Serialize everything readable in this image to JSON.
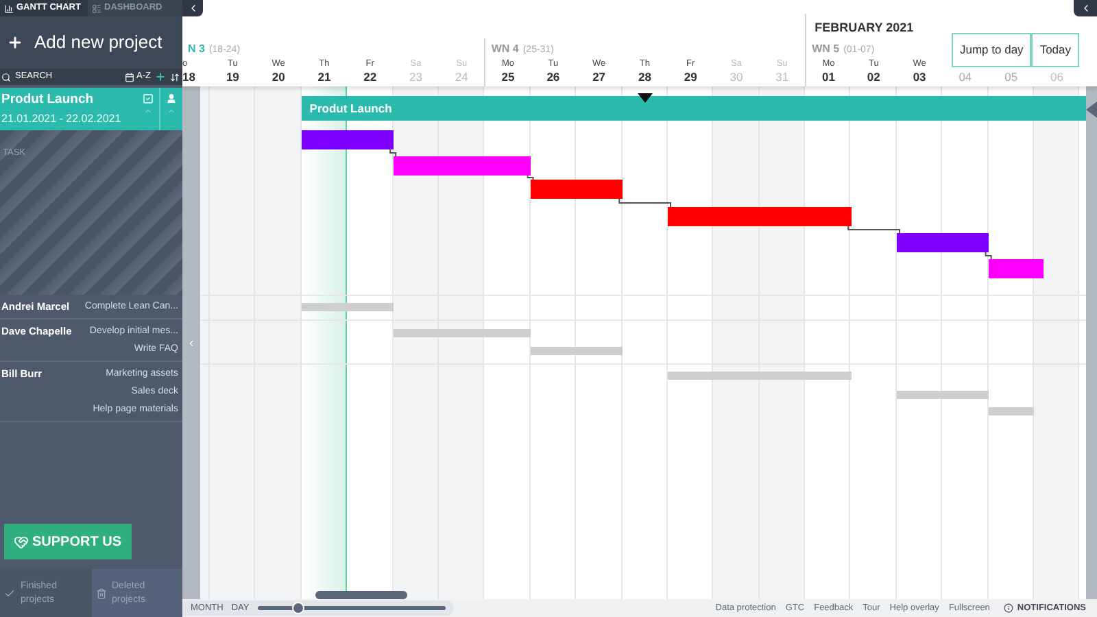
{
  "sidebar": {
    "tabs": [
      {
        "label": "GANTT CHART",
        "selected": true
      },
      {
        "label": "DASHBOARD",
        "selected": false
      }
    ],
    "add_project": "Add new project",
    "search": {
      "label": "SEARCH"
    },
    "sort_label": "A-Z",
    "project": {
      "name": "Produt Launch",
      "dates": "21.01.2021 - 22.02.2021",
      "selected": true
    },
    "task_header": "TASK",
    "resources": [
      {
        "name": "Andrei Marcel",
        "tasks": [
          "Complete Lean Can..."
        ]
      },
      {
        "name": "Dave Chapelle",
        "tasks": [
          "Develop initial mes...",
          "Write FAQ"
        ]
      },
      {
        "name": "Bill Burr",
        "tasks": [
          "Marketing assets",
          "Sales deck",
          "Help page materials"
        ]
      }
    ],
    "support_button": "SUPPORT US",
    "bottom_links": [
      "Finished projects",
      "Deleted projects"
    ]
  },
  "timeline": {
    "month": "FEBRUARY 2021",
    "weeks": [
      {
        "label": "N 3",
        "range": "(18-24)",
        "current": true
      },
      {
        "label": "WN 4",
        "range": "(25-31)",
        "current": false
      },
      {
        "label": "WN 5",
        "range": "(01-07)",
        "current": false
      }
    ],
    "days": [
      {
        "name": "o",
        "date": "18",
        "weekend": false
      },
      {
        "name": "Tu",
        "date": "19",
        "weekend": false
      },
      {
        "name": "We",
        "date": "20",
        "weekend": false
      },
      {
        "name": "Th",
        "date": "21",
        "weekend": false
      },
      {
        "name": "Fr",
        "date": "22",
        "weekend": false
      },
      {
        "name": "Sa",
        "date": "23",
        "weekend": true
      },
      {
        "name": "Su",
        "date": "24",
        "weekend": true
      },
      {
        "name": "Mo",
        "date": "25",
        "weekend": false
      },
      {
        "name": "Tu",
        "date": "26",
        "weekend": false
      },
      {
        "name": "We",
        "date": "27",
        "weekend": false
      },
      {
        "name": "Th",
        "date": "28",
        "weekend": false
      },
      {
        "name": "Fr",
        "date": "29",
        "weekend": false
      },
      {
        "name": "Sa",
        "date": "30",
        "weekend": true
      },
      {
        "name": "Su",
        "date": "31",
        "weekend": true
      },
      {
        "name": "Mo",
        "date": "01",
        "weekend": false
      },
      {
        "name": "Tu",
        "date": "02",
        "weekend": false
      },
      {
        "name": "We",
        "date": "03",
        "weekend": false
      },
      {
        "date": "04",
        "weekend": false
      },
      {
        "date": "05",
        "weekend": false
      },
      {
        "date": "06",
        "weekend": true
      }
    ],
    "buttons": [
      "Jump to day",
      "Today"
    ],
    "project_bar": "Produt Launch",
    "task_bars": [
      {
        "color": "#7f00ff"
      },
      {
        "color": "#ff00ff"
      },
      {
        "color": "#ff0000"
      },
      {
        "color": "#ff0000"
      },
      {
        "color": "#7f00ff"
      },
      {
        "color": "#ff00ff"
      }
    ]
  },
  "footer": {
    "zoom": {
      "labels": [
        "MONTH",
        "DAY"
      ],
      "level": 0.21
    },
    "links": [
      "Data protection",
      "GTC",
      "Feedback",
      "Tour",
      "Help overlay",
      "Fullscreen"
    ],
    "notifications": "NOTIFICATIONS"
  }
}
